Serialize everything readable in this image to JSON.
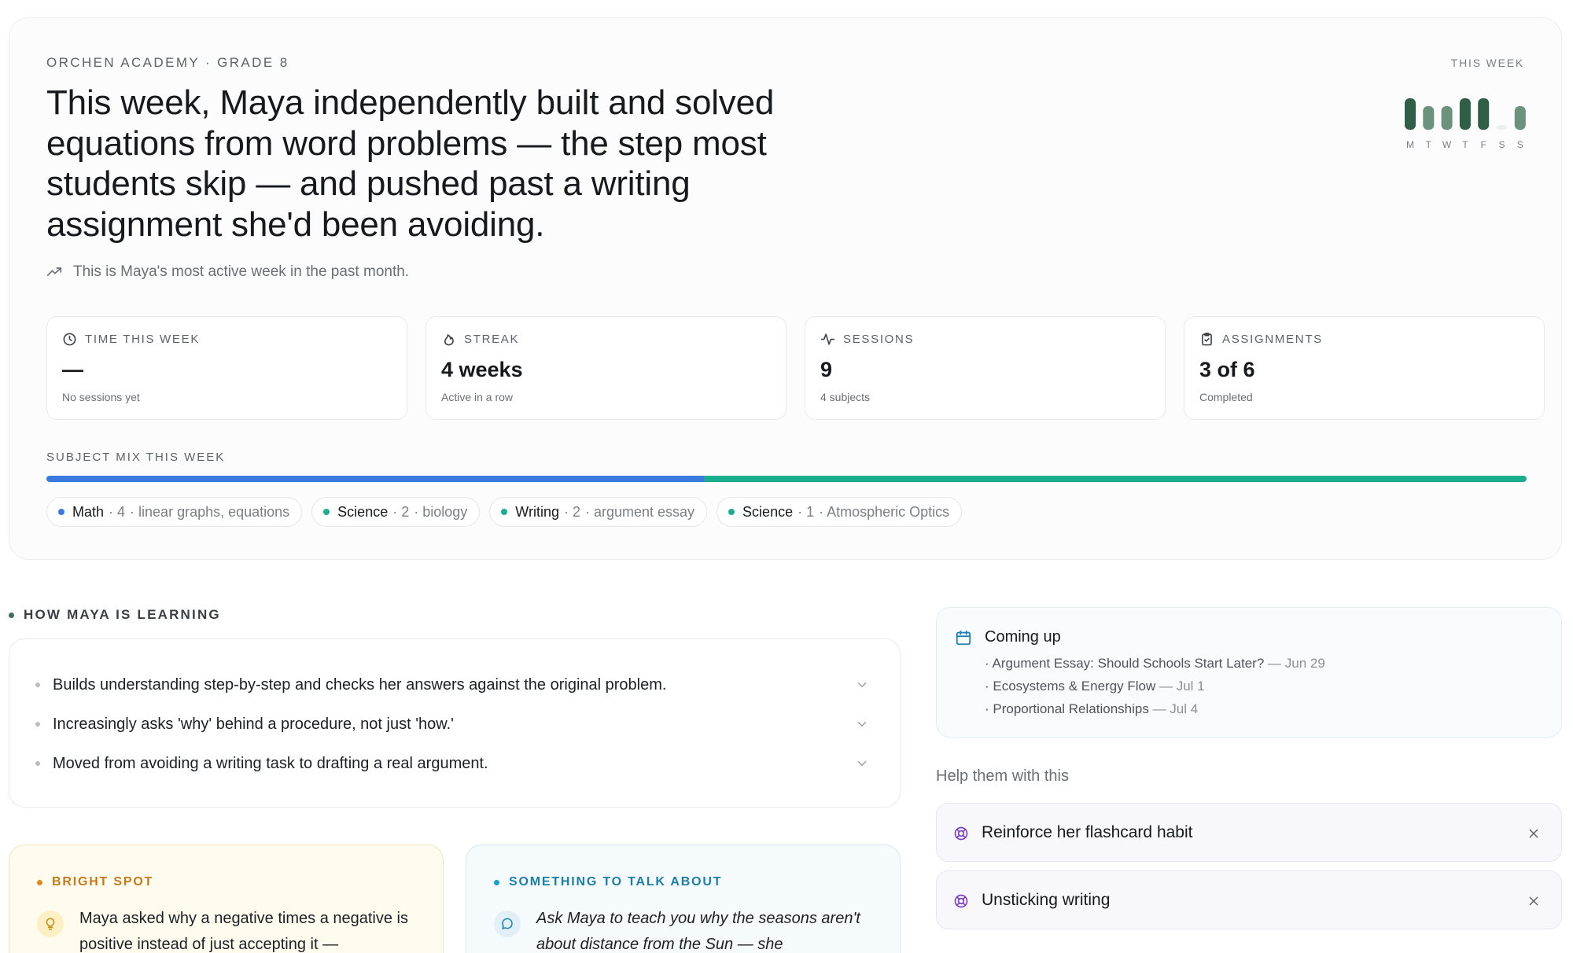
{
  "header": {
    "eyebrow": "ORCHEN ACADEMY · GRADE 8",
    "headline": "This week, Maya independently built and solved equations from word problems — the step most students skip — and pushed past a writing assignment she'd been avoiding.",
    "subnote": "This is Maya's most active week in the past month.",
    "week_label": "THIS WEEK"
  },
  "chart_data": {
    "type": "bar",
    "categories": [
      "M",
      "T",
      "W",
      "T",
      "F",
      "S",
      "S"
    ],
    "values": [
      1.0,
      0.75,
      0.75,
      1.0,
      1.0,
      0.1,
      0.75
    ],
    "ylim": [
      0,
      1
    ],
    "colors": [
      "#2f5f47",
      "#6b927d",
      "#6b927d",
      "#2f5f47",
      "#2f5f47",
      "#edf0ee",
      "#6b927d"
    ]
  },
  "stats": [
    {
      "label": "TIME THIS WEEK",
      "value": "—",
      "sub": "No sessions yet",
      "icon": "clock-icon"
    },
    {
      "label": "STREAK",
      "value": "4 weeks",
      "sub": "Active in a row",
      "icon": "flame-icon"
    },
    {
      "label": "SESSIONS",
      "value": "9",
      "sub": "4 subjects",
      "icon": "activity-icon"
    },
    {
      "label": "ASSIGNMENTS",
      "value": "3 of 6",
      "sub": "Completed",
      "icon": "clipboard-icon"
    }
  ],
  "subject_mix": {
    "label": "SUBJECT MIX THIS WEEK",
    "segments": [
      {
        "fraction": 0.444,
        "color": "#3b7be0"
      },
      {
        "fraction": 0.556,
        "color": "#1aae8f"
      }
    ],
    "chips": [
      {
        "name": "Math",
        "count": "· 4",
        "topic": "· linear graphs, equations",
        "color": "#3b7be0"
      },
      {
        "name": "Science",
        "count": "· 2",
        "topic": "· biology",
        "color": "#1aae8f"
      },
      {
        "name": "Writing",
        "count": "· 2",
        "topic": "· argument essay",
        "color": "#1aae8f"
      },
      {
        "name": "Science",
        "count": "· 1",
        "topic": "· Atmospheric Optics",
        "color": "#1aae8f"
      }
    ]
  },
  "learning": {
    "title": "HOW MAYA IS LEARNING",
    "items": [
      "Builds understanding step-by-step and checks her answers against the original problem.",
      "Increasingly asks 'why' behind a procedure, not just 'how.'",
      "Moved from avoiding a writing task to drafting a real argument."
    ]
  },
  "bright_spot": {
    "title": "BRIGHT SPOT",
    "text": "Maya asked why a negative times a negative is positive instead of just accepting it —",
    "accent": "#c47a1a"
  },
  "talk_about": {
    "title": "SOMETHING TO TALK ABOUT",
    "text": "Ask Maya to teach you why the seasons aren't about distance from the Sun — she",
    "accent": "#1a7fa6"
  },
  "upcoming": {
    "title": "Coming up",
    "items": [
      {
        "name": "· Argument Essay: Should Schools Start Later?",
        "date": " — Jun 29"
      },
      {
        "name": "· Ecosystems & Energy Flow",
        "date": " — Jul 1"
      },
      {
        "name": "· Proportional Relationships",
        "date": " — Jul 4"
      }
    ]
  },
  "help": {
    "label": "Help them with this",
    "items": [
      {
        "label": "Reinforce her flashcard habit"
      },
      {
        "label": "Unsticking writing"
      }
    ]
  }
}
